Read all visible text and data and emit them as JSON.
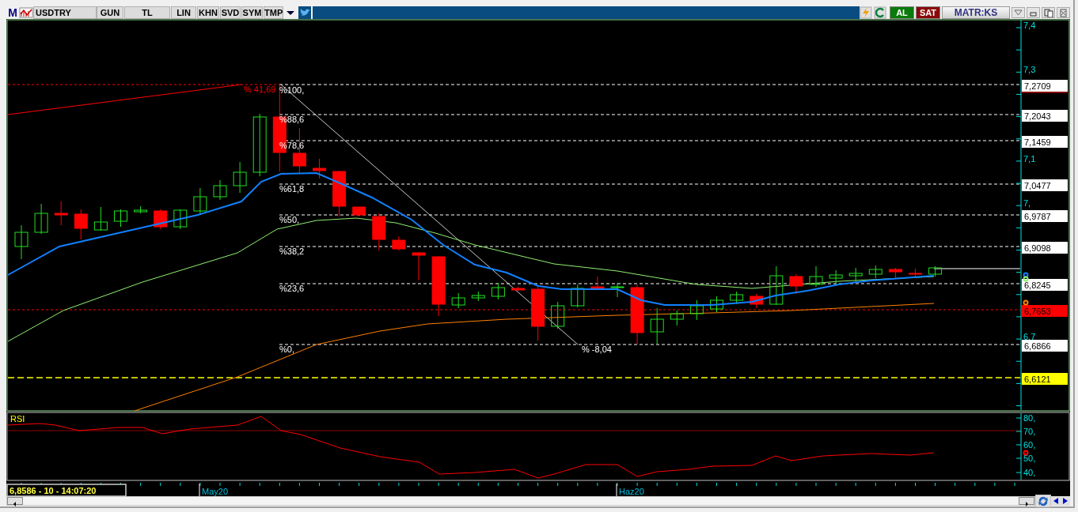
{
  "toolbar": {
    "logo": "M",
    "symbol": "USDTRY",
    "buttons": [
      "GUN",
      "TL",
      "LIN",
      "KHN",
      "SVD",
      "SYM",
      "TMP"
    ],
    "actions": [
      {
        "label": "AL",
        "kind": "buy"
      },
      {
        "label": "SAT",
        "kind": "sell"
      }
    ],
    "brand": "MATR:KS"
  },
  "price_chart": {
    "axis_ticks": [
      "7,4",
      "7,3",
      "7,1",
      "7,",
      "6,7"
    ],
    "price_labels": [
      {
        "text": "7,2709",
        "color": "#ffffff"
      },
      {
        "text": "7,2043",
        "color": "#ffffff"
      },
      {
        "text": "7,1459",
        "color": "#ffffff"
      },
      {
        "text": "7,0477",
        "color": "#ffffff"
      },
      {
        "text": "6,9787",
        "color": "#ffffff"
      },
      {
        "text": "6,9098",
        "color": "#ffffff"
      },
      {
        "text": "6,8245",
        "color": "#ffffff"
      },
      {
        "text": "6,7653",
        "color": "#ff0000"
      },
      {
        "text": "6,6866",
        "color": "#ffffff"
      },
      {
        "text": "6,6121",
        "color": "#ffff00"
      }
    ],
    "fibonacci_levels": [
      "%100,",
      "%88,6",
      "%78,6",
      "%61,8",
      "%50,",
      "%38,2",
      "%23,6",
      "%0,"
    ],
    "trend_labels": [
      {
        "text": "% 41,69",
        "color": "#ff0000"
      },
      {
        "text": "% -8,04",
        "color": "#ffffff"
      }
    ]
  },
  "rsi_panel": {
    "title": "RSI",
    "axis_ticks": [
      "80,",
      "70,",
      "60,",
      "50,",
      "40,"
    ]
  },
  "time_axis": {
    "labels": [
      "May20",
      "Haz20"
    ]
  },
  "status": "6,8586 - 10 - 14:07:20"
}
